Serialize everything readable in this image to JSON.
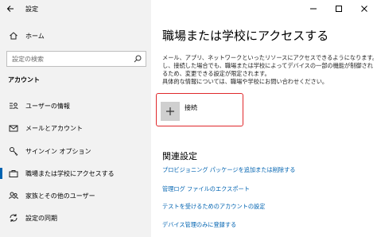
{
  "window": {
    "title": "設定"
  },
  "sidebar": {
    "home_label": "ホーム",
    "search_placeholder": "設定の検索",
    "section_label": "アカウント",
    "items": [
      {
        "label": "ユーザーの情報",
        "icon": "user-info-icon"
      },
      {
        "label": "メールとアカウント",
        "icon": "mail-icon"
      },
      {
        "label": "サインイン オプション",
        "icon": "key-icon"
      },
      {
        "label": "職場または学校にアクセスする",
        "icon": "briefcase-icon",
        "active": true
      },
      {
        "label": "家族とその他のユーザー",
        "icon": "people-icon"
      },
      {
        "label": "設定の同期",
        "icon": "sync-icon"
      }
    ]
  },
  "main": {
    "title": "職場または学校にアクセスする",
    "description": [
      "メール、アプリ、ネットワークといったリソースにアクセスできるようになります。ただ",
      "し、接続した場合でも、職場または学校によってデバイスの一部の機能が制御され",
      "るため、変更できる設定が限定されます。",
      "具体的な情報については、職場や学校にお問い合わせください。"
    ],
    "connect_label": "接続",
    "related_title": "関連設定",
    "links": [
      "プロビジョニング パッケージを追加または削除する",
      "管理ログ ファイルのエクスポート",
      "テストを受けるためのアカウントの設定",
      "デバイス管理のみに登録する"
    ]
  },
  "colors": {
    "accent": "#0063b1",
    "highlight_border": "#e0282b",
    "sidebar_bg": "#f2f2f2"
  }
}
